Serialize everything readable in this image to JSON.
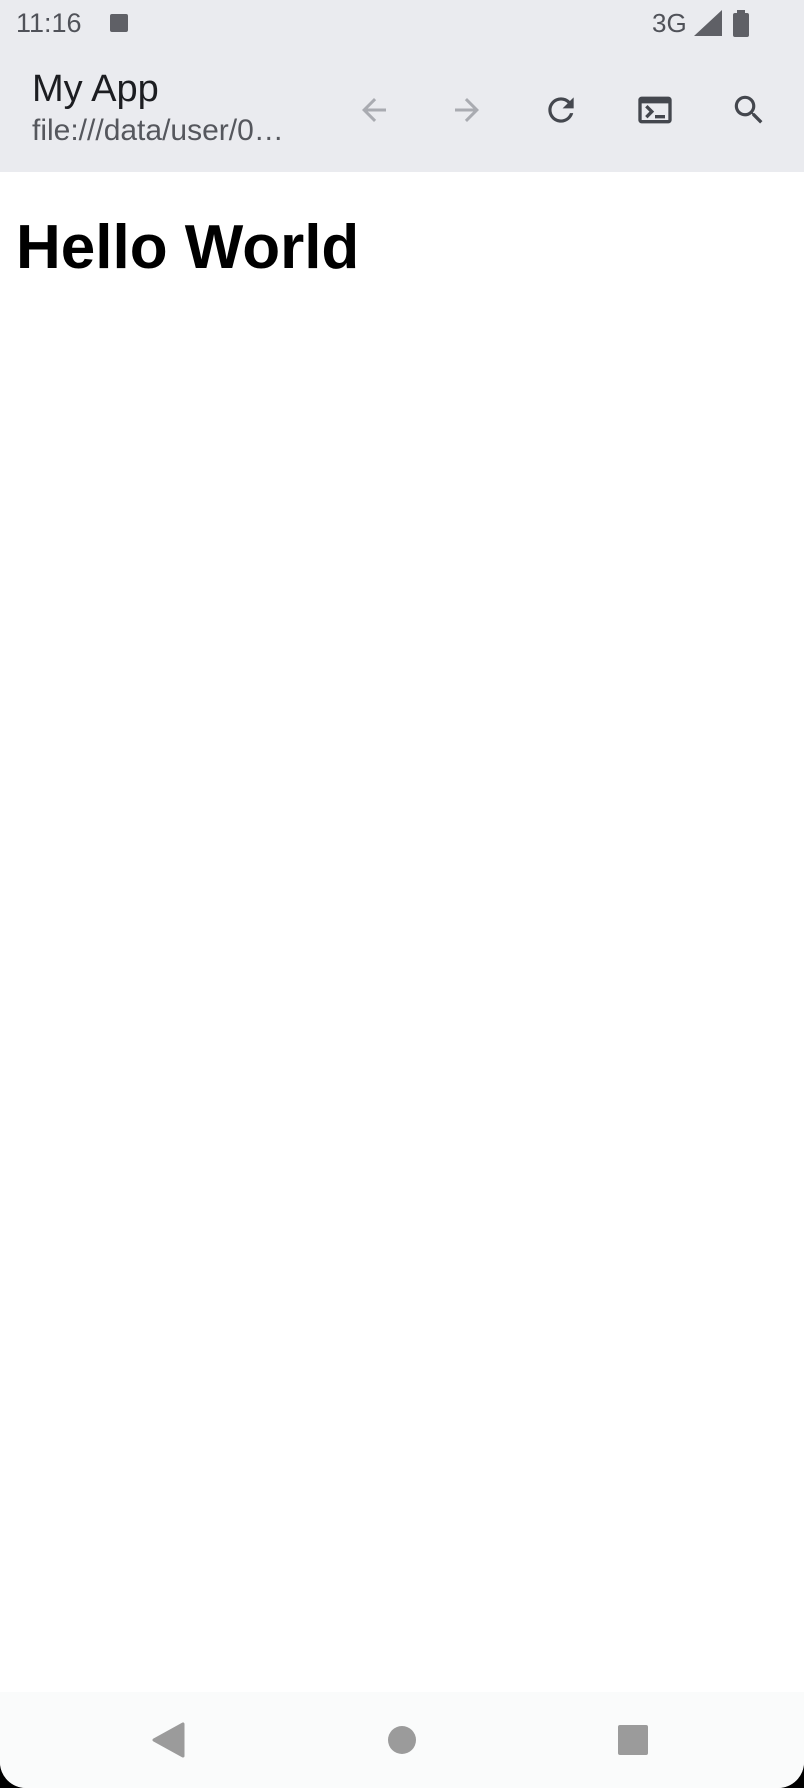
{
  "status_bar": {
    "time": "11:16",
    "network": "3G",
    "icons": [
      "notification-square-icon",
      "cell-signal-icon",
      "battery-icon"
    ]
  },
  "app_bar": {
    "title": "My App",
    "url": "file:///data/user/0…",
    "actions": [
      {
        "name": "back",
        "icon": "arrow-left-icon",
        "enabled": false
      },
      {
        "name": "forward",
        "icon": "arrow-right-icon",
        "enabled": false
      },
      {
        "name": "reload",
        "icon": "refresh-icon",
        "enabled": true
      },
      {
        "name": "console",
        "icon": "terminal-icon",
        "enabled": true
      },
      {
        "name": "search",
        "icon": "search-icon",
        "enabled": true
      }
    ]
  },
  "content": {
    "heading": "Hello World"
  },
  "nav_bar": {
    "buttons": [
      "back-triangle-icon",
      "home-circle-icon",
      "recents-square-icon"
    ]
  },
  "colors": {
    "app_bar_bg": "#eaebef",
    "icon_active": "#44474e",
    "icon_disabled": "#a9abb1",
    "nav_icon": "#9b9b9b"
  }
}
